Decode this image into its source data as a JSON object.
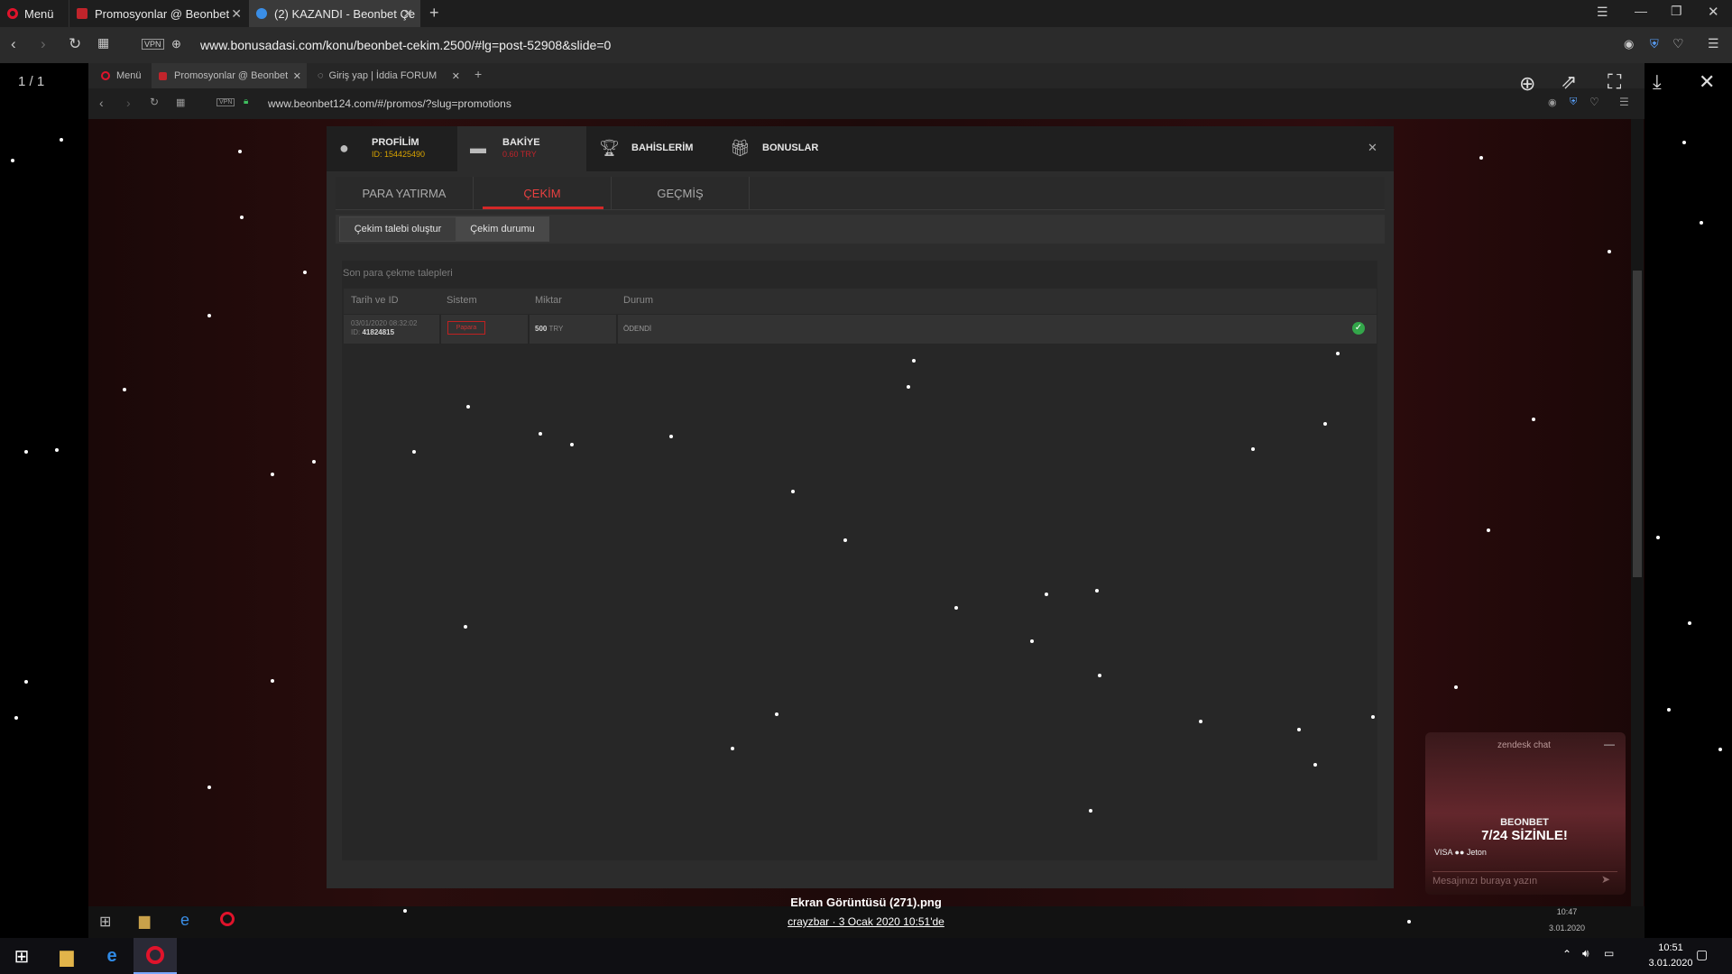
{
  "outer_browser": {
    "menu_label": "Menü",
    "tabs": [
      {
        "label": "Promosyonlar @ Beonbet"
      },
      {
        "label": "(2) KAZANDI - Beonbet Çe"
      }
    ],
    "url": "www.bonusadasi.com/konu/beonbet-cekim.2500/#lg=post-52908&slide=0",
    "vpn_label": "VPN"
  },
  "viewer": {
    "counter": "1 / 1",
    "caption_file": "Ekran Görüntüsü (271).png",
    "caption_author": "crayzbar · 3 Ocak 2020 10:51'de"
  },
  "inner_browser": {
    "menu_label": "Menü",
    "tabs": [
      {
        "label": "Promosyonlar @ Beonbet"
      },
      {
        "label": "Giriş yap | İddia FORUM"
      }
    ],
    "url": "www.beonbet124.com/#/promos/?slug=promotions",
    "vpn_label": "VPN"
  },
  "modal": {
    "tabs": [
      {
        "label": "PROFİLİM",
        "sub": "ID: 154425490"
      },
      {
        "label": "BAKİYE",
        "sub": "0.60 TRY"
      },
      {
        "label": "BAHİSLERİM",
        "sub": ""
      },
      {
        "label": "BONUSLAR",
        "sub": ""
      }
    ],
    "subtabs": [
      "PARA YATIRMA",
      "ÇEKİM",
      "GEÇMİŞ"
    ],
    "buttons": [
      "Çekim talebi oluştur",
      "Çekim durumu"
    ],
    "section_title": "Son para çekme talepleri",
    "columns": [
      "Tarih ve ID",
      "Sistem",
      "Miktar",
      "Durum"
    ],
    "rows": [
      {
        "date": "03/01/2020 08:32:02",
        "id_label": "ID:",
        "id": "41824815",
        "system": "Papara",
        "amount": "500",
        "currency": "TRY",
        "status": "ÖDENDİ"
      }
    ]
  },
  "chat": {
    "title": "zendesk chat",
    "brand": "BEONBET",
    "slogan": "7/24 SİZİNLE!",
    "payments": "VISA  ●●  Jeton",
    "input_placeholder": "Mesajınızı buraya yazın"
  },
  "inner_clock": {
    "time": "10:47",
    "date": "3.01.2020"
  },
  "clock": {
    "time": "10:51",
    "date": "3.01.2020"
  },
  "colors": {
    "accent": "#d32828",
    "status_ok": "#33a64a",
    "balance": "#c0242b",
    "profile_id": "#d9a400"
  }
}
